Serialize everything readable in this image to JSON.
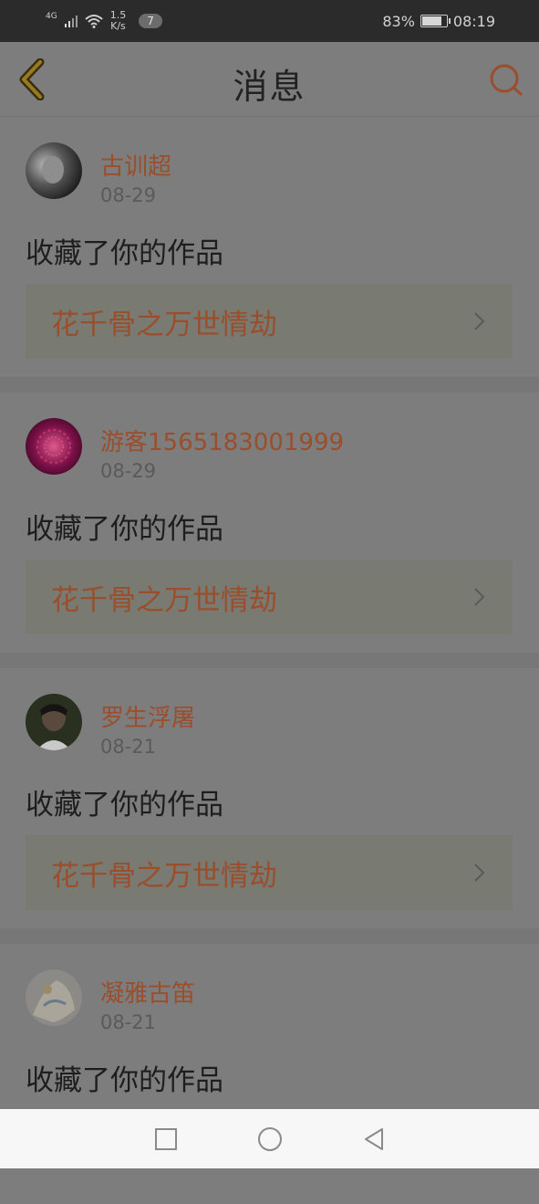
{
  "status_bar": {
    "network": "4G",
    "speed": "1.5",
    "speed_unit": "K/s",
    "badge": "7",
    "battery": "83%",
    "time": "08:19"
  },
  "header": {
    "title": "消息",
    "back_icon": "back-chevron-icon",
    "search_icon": "search-icon"
  },
  "colors": {
    "accent": "#9a4e2c",
    "text": "#1e1e1e",
    "date": "#5a5a5a"
  },
  "messages": [
    {
      "user": "古训超",
      "date": "08-29",
      "action": "收藏了你的作品",
      "work": "花千骨之万世情劫"
    },
    {
      "user": "游客1565183001999",
      "date": "08-29",
      "action": "收藏了你的作品",
      "work": "花千骨之万世情劫"
    },
    {
      "user": "罗生浮屠",
      "date": "08-21",
      "action": "收藏了你的作品",
      "work": "花千骨之万世情劫"
    },
    {
      "user": "凝雅古笛",
      "date": "08-21",
      "action": "收藏了你的作品"
    }
  ],
  "nav": {
    "recents": "square-icon",
    "home": "circle-icon",
    "back": "triangle-back-icon"
  }
}
